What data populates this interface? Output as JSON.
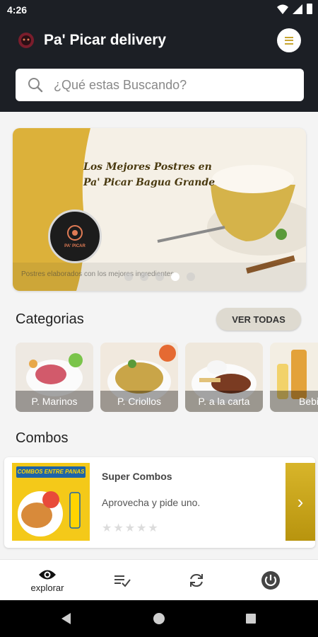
{
  "status": {
    "time": "4:26"
  },
  "header": {
    "title": "Pa' Picar delivery"
  },
  "search": {
    "placeholder": "¿Qué estas Buscando?"
  },
  "banner": {
    "line1": "Los Mejores Postres en",
    "line2": "Pa' Picar Bagua Grande",
    "logo_text": "PA' PICAR",
    "caption": "Postres elaborados con los mejores ingredientes",
    "dots_count": 5,
    "active_dot": 3
  },
  "categories": {
    "title": "Categorias",
    "see_all": "VER TODAS",
    "items": [
      {
        "label": "P. Marinos"
      },
      {
        "label": "P. Criollos"
      },
      {
        "label": "P. a la carta"
      },
      {
        "label": "Bebi"
      }
    ]
  },
  "combos": {
    "title": "Combos",
    "card": {
      "image_text": "COMBOS ENTRE PANAS",
      "name": "Super Combos",
      "description": "Aprovecha y pide uno.",
      "rating": 0,
      "max_rating": 5
    }
  },
  "bottom_nav": {
    "items": [
      {
        "label": "explorar",
        "icon": "eye-icon",
        "active": true
      },
      {
        "label": "",
        "icon": "list-check-icon"
      },
      {
        "label": "",
        "icon": "refresh-icon"
      },
      {
        "label": "",
        "icon": "power-icon"
      }
    ]
  },
  "colors": {
    "header": "#1c1f25",
    "accent": "#c8a531",
    "button": "#dedad0"
  }
}
